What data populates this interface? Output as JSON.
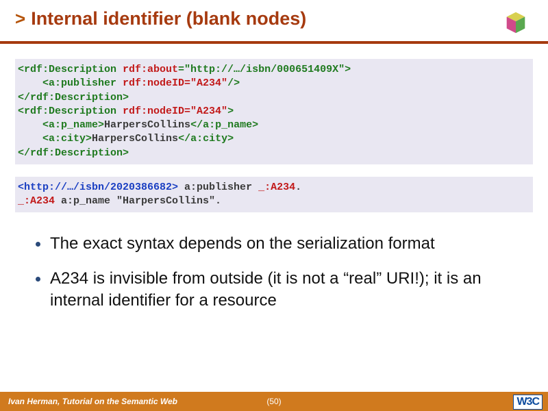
{
  "header": {
    "chevron": ">",
    "title": "Internal identifier (blank nodes)"
  },
  "code1": {
    "l1a": "<rdf:Description ",
    "l1b": "rdf:about",
    "l1c": "=\"http://…/isbn/000651409X\">",
    "l2a": "    <a:publisher ",
    "l2b": "rdf:nodeID=\"A234\"",
    "l2c": "/>",
    "l3": "</rdf:Description>",
    "l4a": "<rdf:Description ",
    "l4b": "rdf:nodeID=\"A234\"",
    "l4c": ">",
    "l5a": "    <a:p_name>",
    "l5b": "HarpersCollins",
    "l5c": "</a:p_name>",
    "l6a": "    <a:city>",
    "l6b": "HarpersCollins",
    "l6c": "</a:city>",
    "l7": "</rdf:Description>"
  },
  "code2": {
    "l1a": "<http://…/isbn/2020386682>",
    "l1b": " a:publisher ",
    "l1c": "_:A234",
    "l1d": ".",
    "l2a": "_:A234",
    "l2b": " a:p_name ",
    "l2c": "\"HarpersCollins\".",
    "l2d": ""
  },
  "bullets": {
    "b1": "The exact syntax depends on the serialization format",
    "b2": "A234 is invisible from outside (it is not a “real” URI!); it is an internal identifier for a resource"
  },
  "footer": {
    "left": "Ivan Herman, Tutorial on the Semantic Web",
    "page": "(50)",
    "w3c": "W3C"
  }
}
